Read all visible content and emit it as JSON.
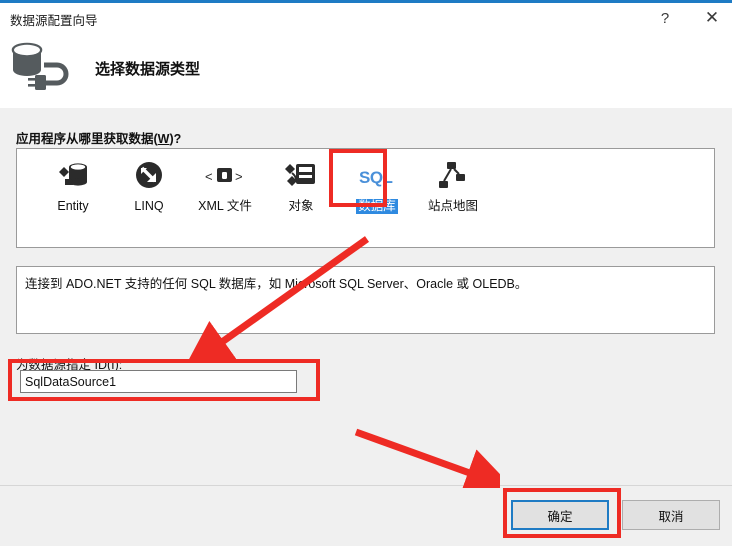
{
  "window": {
    "title": "数据源配置向导",
    "help_label": "?",
    "close_label": "✕",
    "accent_color": "#1e7bc4"
  },
  "header": {
    "title": "选择数据源类型",
    "icon": "database-plug-icon"
  },
  "main": {
    "prompt_label_prefix": "应用程序从哪里获取数据(",
    "prompt_accesskey": "W",
    "prompt_label_suffix": ")?",
    "sources": [
      {
        "label": "Entity",
        "icon": "entity-icon",
        "selected": false
      },
      {
        "label": "LINQ",
        "icon": "linq-icon",
        "selected": false
      },
      {
        "label": "XML 文件",
        "icon": "xml-file-icon",
        "selected": false
      },
      {
        "label": "对象",
        "icon": "object-icon",
        "selected": false
      },
      {
        "label": "数据库",
        "icon": "sql-database-icon",
        "selected": true
      },
      {
        "label": "站点地图",
        "icon": "site-map-icon",
        "selected": false
      }
    ],
    "description": "连接到 ADO.NET 支持的任何 SQL 数据库，如 Microsoft SQL Server、Oracle 或 OLEDB。",
    "id_label": "为数据源指定 ID(I):",
    "id_value": "SqlDataSource1",
    "id_placeholder": ""
  },
  "footer": {
    "ok_label": "确定",
    "cancel_label": "取消"
  },
  "annotations": {
    "color": "#ee2b24",
    "boxes": [
      "database-source-item",
      "data-source-id-input",
      "ok-button"
    ],
    "arrows": [
      "arrow-to-id-input",
      "arrow-to-ok-button"
    ]
  }
}
